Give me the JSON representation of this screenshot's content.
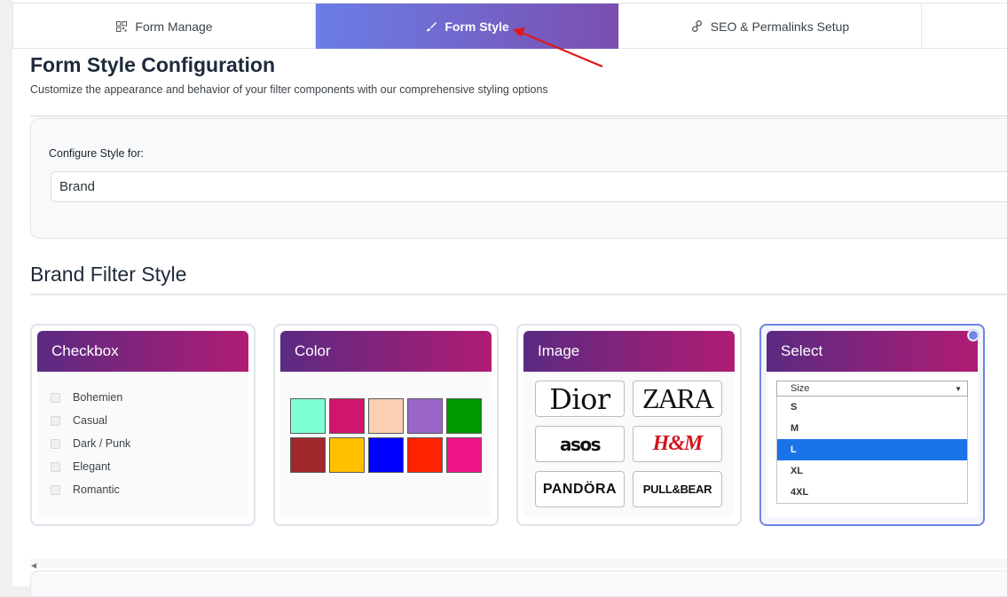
{
  "tabs": [
    {
      "label": "Form Manage",
      "icon": "qr-grid-icon"
    },
    {
      "label": "Form Style",
      "icon": "brush-icon"
    },
    {
      "label": "SEO & Permalinks Setup",
      "icon": "link-icon"
    }
  ],
  "header": {
    "title": "Form Style Configuration",
    "subtitle": "Customize the appearance and behavior of your filter components with our comprehensive styling options"
  },
  "config": {
    "label": "Configure Style for:",
    "selected": "Brand"
  },
  "section_title": "Brand Filter Style",
  "cards": {
    "checkbox": {
      "title": "Checkbox",
      "items": [
        "Bohemien",
        "Casual",
        "Dark / Punk",
        "Elegant",
        "Romantic"
      ]
    },
    "color": {
      "title": "Color",
      "swatches": [
        "#7fffd4",
        "#d0156d",
        "#fbcfb1",
        "#9a66c9",
        "#009900",
        "#a0282a",
        "#ffc000",
        "#0000ff",
        "#ff2200",
        "#ef1389"
      ]
    },
    "image": {
      "title": "Image",
      "logos": [
        "Dior",
        "ZARA",
        "asos",
        "H&M",
        "PANDÖRA",
        "PULL&BEAR"
      ]
    },
    "select": {
      "title": "Select",
      "placeholder": "Size",
      "options": [
        "S",
        "M",
        "L",
        "XL",
        "4XL"
      ],
      "active_option": "L"
    }
  },
  "colors": {
    "accent_tab_start": "#6a7ee6",
    "accent_tab_end": "#7a4fb0",
    "card_head_start": "#5b2a82",
    "card_head_end": "#b01c74",
    "selected_border": "#6e85e3",
    "arrow": "#e01919"
  }
}
